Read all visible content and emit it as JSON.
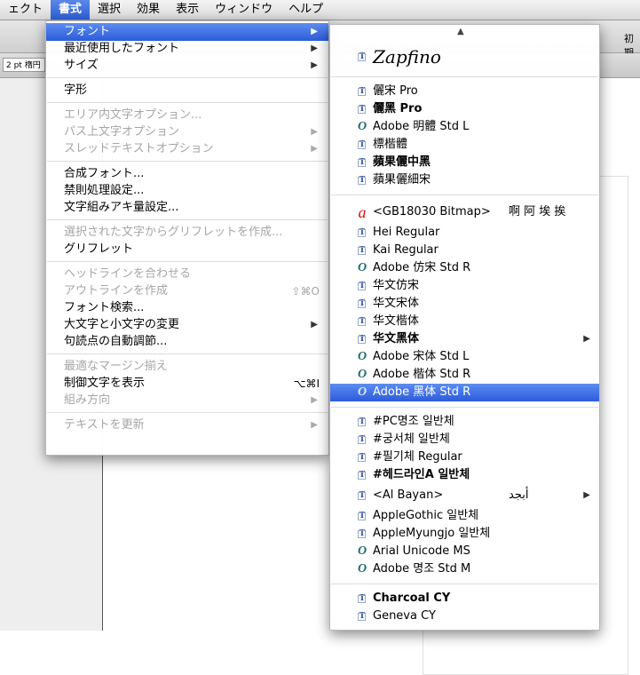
{
  "menubar": {
    "items": [
      {
        "label": "ェクト",
        "active": false
      },
      {
        "label": "書式",
        "active": true
      },
      {
        "label": "選択",
        "active": false
      },
      {
        "label": "効果",
        "active": false
      },
      {
        "label": "表示",
        "active": false
      },
      {
        "label": "ウィンドウ",
        "active": false
      },
      {
        "label": "ヘルプ",
        "active": false
      }
    ]
  },
  "background": {
    "stroke_value": "2 pt 楕円",
    "right_label": "初期"
  },
  "format_menu": {
    "groups": [
      [
        {
          "label": "フォント",
          "state": "highlighted",
          "submenu": true
        },
        {
          "label": "最近使用したフォント",
          "state": "enabled",
          "submenu": true
        },
        {
          "label": "サイズ",
          "state": "enabled",
          "submenu": true
        }
      ],
      [
        {
          "label": "字形",
          "state": "enabled"
        }
      ],
      [
        {
          "label": "エリア内文字オプション...",
          "state": "disabled"
        },
        {
          "label": "パス上文字オプション",
          "state": "disabled",
          "submenu": true
        },
        {
          "label": "スレッドテキストオプション",
          "state": "disabled",
          "submenu": true
        }
      ],
      [
        {
          "label": "合成フォント...",
          "state": "enabled"
        },
        {
          "label": "禁則処理設定...",
          "state": "enabled"
        },
        {
          "label": "文字組みアキ量設定...",
          "state": "enabled"
        }
      ],
      [
        {
          "label": "選択された文字からグリフレットを作成...",
          "state": "disabled"
        },
        {
          "label": "グリフレット",
          "state": "enabled"
        }
      ],
      [
        {
          "label": "ヘッドラインを合わせる",
          "state": "disabled"
        },
        {
          "label": "アウトラインを作成",
          "state": "disabled",
          "shortcut": "⇧⌘O"
        },
        {
          "label": "フォント検索...",
          "state": "enabled"
        },
        {
          "label": "大文字と小文字の変更",
          "state": "enabled",
          "submenu": true
        },
        {
          "label": "句読点の自動調節...",
          "state": "enabled"
        }
      ],
      [
        {
          "label": "最適なマージン揃え",
          "state": "disabled"
        },
        {
          "label": "制御文字を表示",
          "state": "enabled",
          "shortcut": "⌥⌘I"
        },
        {
          "label": "組み方向",
          "state": "disabled",
          "submenu": true
        }
      ],
      [
        {
          "label": "テキストを更新",
          "state": "disabled",
          "submenu": true
        }
      ]
    ]
  },
  "font_submenu": {
    "scroll_up_icon": "triangle-up-icon",
    "groups": [
      [
        {
          "name": "Zapfino",
          "icon": "tt",
          "script": true
        }
      ],
      [
        {
          "name": "儷宋 Pro",
          "icon": "tt"
        },
        {
          "name": "儷黑 Pro",
          "icon": "tt",
          "bold": true
        },
        {
          "name": "Adobe 明體 Std L",
          "icon": "ot"
        },
        {
          "name": "標楷體",
          "icon": "tt"
        },
        {
          "name": "蘋果儷中黑",
          "icon": "tt",
          "bold": true
        },
        {
          "name": "蘋果儷細宋",
          "icon": "tt"
        }
      ],
      [
        {
          "name": "<GB18030 Bitmap>",
          "icon": "bm",
          "sample": "啊 阿 埃 挨",
          "tall": true
        },
        {
          "name": "Hei Regular",
          "icon": "tt"
        },
        {
          "name": "Kai Regular",
          "icon": "tt"
        },
        {
          "name": "Adobe 仿宋 Std R",
          "icon": "ot"
        },
        {
          "name": "华文仿宋",
          "icon": "tt"
        },
        {
          "name": "华文宋体",
          "icon": "tt"
        },
        {
          "name": "华文楷体",
          "icon": "tt"
        },
        {
          "name": "华文黑体",
          "icon": "tt",
          "bold": true,
          "submenu": true
        },
        {
          "name": "Adobe 宋体 Std L",
          "icon": "ot"
        },
        {
          "name": "Adobe 楷体 Std R",
          "icon": "ot"
        },
        {
          "name": "Adobe 黑体 Std R",
          "icon": "ot",
          "highlighted": true
        }
      ],
      [
        {
          "name": "#PC명조 일반체",
          "icon": "tt"
        },
        {
          "name": "#궁서체 일반체",
          "icon": "tt"
        },
        {
          "name": "#필기체 Regular",
          "icon": "tt"
        },
        {
          "name": "#헤드라인A 일반체",
          "icon": "tt",
          "bold": true
        },
        {
          "name": "<Al Bayan>",
          "icon": "tt",
          "sample": "ﺃﺑﺠﺪ",
          "submenu": true,
          "tall": true
        },
        {
          "name": "AppleGothic 일반체",
          "icon": "tt"
        },
        {
          "name": "AppleMyungjo 일반체",
          "icon": "tt"
        },
        {
          "name": "Arial Unicode MS",
          "icon": "ot"
        },
        {
          "name": "Adobe 명조 Std M",
          "icon": "ot"
        }
      ],
      [
        {
          "name": "Charcoal CY",
          "icon": "tt",
          "bold": true
        },
        {
          "name": "Geneva CY",
          "icon": "tt"
        }
      ]
    ]
  }
}
